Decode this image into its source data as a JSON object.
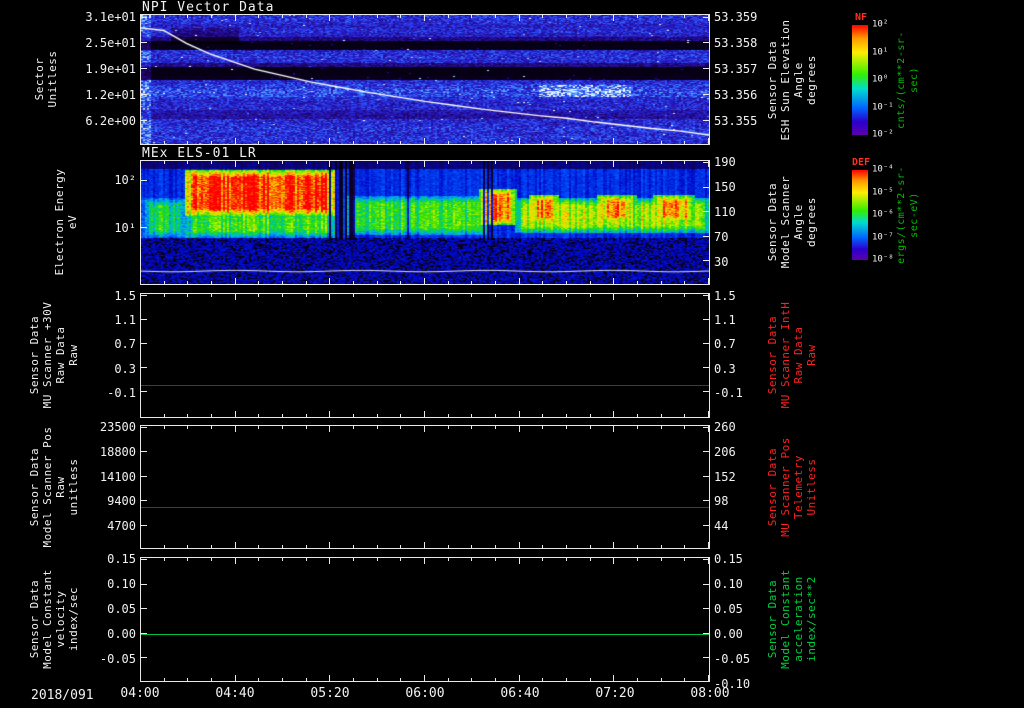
{
  "page": {
    "background": "#000000"
  },
  "time_axis": {
    "date_label": "2018/091",
    "tick_labels": [
      "04:00",
      "04:40",
      "05:20",
      "06:00",
      "06:40",
      "07:20",
      "08:00"
    ]
  },
  "panels": [
    {
      "title": "NPI Vector Data",
      "left_label": "Sector\nUnitless",
      "left_ticks": [
        "3.1e+01",
        "2.5e+01",
        "1.9e+01",
        "1.2e+01",
        "6.2e+00"
      ],
      "right_ticks": [
        "53.359",
        "53.358",
        "53.357",
        "53.356",
        "53.355"
      ],
      "right_label": "Sensor Data\nESH Sun Elevation\nAngle\ndegrees",
      "right_label_color": "#f2f2f2"
    },
    {
      "title": "MEx ELS-01 LR",
      "left_label": "Electron Energy\neV",
      "left_ticks": [
        "10²",
        "10¹"
      ],
      "right_ticks": [
        "190",
        "150",
        "110",
        "70",
        "30"
      ],
      "right_label": "Sensor Data\nModel Scanner\nAngle\ndegrees",
      "right_label_color": "#f2f2f2"
    },
    {
      "left_label": "Sensor Data\nMU Scanner +30V\nRaw Data\nRaw",
      "left_ticks": [
        "1.5",
        "1.1",
        "0.7",
        "0.3",
        "-0.1"
      ],
      "right_ticks": [
        "1.5",
        "1.1",
        "0.7",
        "0.3",
        "-0.1"
      ],
      "right_label": "Sensor Data\nMU Scanner IntH\nRaw Data\nRaw",
      "right_label_color": "#ff2020"
    },
    {
      "left_label": "Sensor Data\nModel Scanner Pos\nRaw\nunitless",
      "left_ticks": [
        "23500",
        "18800",
        "14100",
        "9400",
        "4700"
      ],
      "right_ticks": [
        "260",
        "206",
        "152",
        "98",
        "44"
      ],
      "right_label": "Sensor Data\nMU Scanner Pos\nTelemetry\nUnitless",
      "right_label_color": "#ff2020"
    },
    {
      "left_label": "Sensor Data\nModel Constant\nvelocity\nindex/sec",
      "left_ticks": [
        "0.15",
        "0.10",
        "0.05",
        "0.00",
        "-0.05"
      ],
      "right_ticks": [
        "0.15",
        "0.10",
        "0.05",
        "0.00",
        "-0.05",
        "-0.10"
      ],
      "right_label": "Sensor Data\nModel Constant\nacceleration\nindex/sec**2",
      "right_label_color": "#00d040"
    }
  ],
  "colorbars": [
    {
      "title": "NF",
      "ticks": [
        "10²",
        "10¹",
        "10⁰",
        "10⁻¹",
        "10⁻²"
      ],
      "units": "cnts/(cm**2-sr-sec)"
    },
    {
      "title": "DEF",
      "ticks": [
        "10⁻⁴",
        "10⁻⁵",
        "10⁻⁶",
        "10⁻⁷",
        "10⁻⁸"
      ],
      "units": "ergs/(cm**2-sr-sec-eV)"
    }
  ],
  "chart_data": [
    {
      "type": "heatmap",
      "title": "NPI Vector Data",
      "ylabel": "Sector (Unitless)",
      "yticks": [
        31,
        25,
        19,
        12,
        6.2
      ],
      "x_span": [
        "2018/091 04:00",
        "2018/091 08:00"
      ],
      "z_label": "NF cnts/(cm**2-sr-sec)",
      "z_log_range": [
        -2,
        2
      ],
      "description": "Low-count blue/purple sector-vs-time spectrogram with black bands near sectors 17-19 and 24-25",
      "overlay": {
        "name": "ESH Sun Elevation Angle",
        "units": "degrees",
        "right_axis_ticks": [
          53.359,
          53.358,
          53.357,
          53.356,
          53.355
        ],
        "start_value": 53.3585,
        "end_value": 53.3552,
        "curve_xfrac": [
          0,
          0.04,
          0.08,
          0.12,
          0.16,
          0.2,
          0.25,
          0.3,
          0.35,
          0.4,
          0.45,
          0.5,
          0.55,
          0.6,
          0.65,
          0.7,
          0.75,
          0.8,
          0.85,
          0.9,
          0.95,
          1
        ],
        "curve_yfrac": [
          0.1,
          0.12,
          0.22,
          0.3,
          0.36,
          0.42,
          0.47,
          0.52,
          0.56,
          0.6,
          0.635,
          0.67,
          0.7,
          0.73,
          0.755,
          0.78,
          0.8,
          0.83,
          0.855,
          0.88,
          0.9,
          0.93
        ]
      },
      "render": {
        "seed": 12345,
        "rows": [
          0.52,
          0.5,
          0.46,
          0.5,
          0.46,
          0.3,
          0.05,
          0.06,
          0.5,
          0.52,
          0.5,
          0.3,
          0.05,
          0.05,
          0.07,
          0.5,
          0.55,
          0.6,
          0.58,
          0.5,
          0.47,
          0.5,
          0.4,
          0.36,
          0.5,
          0.5,
          0.53,
          0.5,
          0.53,
          0.5
        ],
        "patches": [
          {
            "x0": 0.05,
            "x1": 0.17,
            "y0": 0.1,
            "y1": 0.22,
            "boost": -0.18
          },
          {
            "x0": 0.7,
            "x1": 0.86,
            "y0": 0.54,
            "y1": 0.63,
            "boost": 0.22
          },
          {
            "x0": 0.0,
            "x1": 0.015,
            "y0": 0.0,
            "y1": 1.0,
            "boost": 0.18
          }
        ],
        "colormap": [
          [
            0,
            "#000005"
          ],
          [
            0.18,
            "#17003f"
          ],
          [
            0.33,
            "#250c96"
          ],
          [
            0.5,
            "#2526d8"
          ],
          [
            0.63,
            "#2e4df0"
          ],
          [
            0.75,
            "#3f8bff"
          ],
          [
            0.88,
            "#9fd4ff"
          ],
          [
            1,
            "#ffffff"
          ]
        ]
      }
    },
    {
      "type": "heatmap",
      "title": "MEx ELS-01 LR",
      "ylabel": "Electron Energy (eV)",
      "yticks": [
        100,
        10
      ],
      "right_axis": {
        "name": "Model Scanner Angle (degrees)",
        "ticks": [
          190,
          150,
          110,
          70,
          30
        ]
      },
      "z_label": "DEF ergs/(cm**2-sr-sec-eV)",
      "z_log_range": [
        -8,
        -4
      ],
      "description": "Electron energy-time spectrogram: intense red high-energy band 04:10-05:20, striped green band 05:25-06:25, yellow-green band with red patches 06:30-08:00, blue noisy background below",
      "render": {
        "seed": 777,
        "bg_levels": {
          "top": 0.15,
          "mid": 0.27,
          "bottom": 0.21
        },
        "regions": [
          {
            "x0": 0.0,
            "x1": 0.08,
            "y0": 0.3,
            "y1": 0.62,
            "v": 0.52
          },
          {
            "x0": 0.075,
            "x1": 0.345,
            "y0": 0.07,
            "y1": 0.44,
            "v": 0.97
          },
          {
            "x0": 0.075,
            "x1": 0.345,
            "y0": 0.4,
            "y1": 0.62,
            "v": 0.58
          },
          {
            "x0": 0.36,
            "x1": 0.61,
            "y0": 0.28,
            "y1": 0.6,
            "v": 0.56
          },
          {
            "x0": 0.595,
            "x1": 0.66,
            "y0": 0.22,
            "y1": 0.52,
            "v": 0.9
          },
          {
            "x0": 0.655,
            "x1": 1.0,
            "y0": 0.3,
            "y1": 0.58,
            "v": 0.66
          },
          {
            "x0": 0.68,
            "x1": 0.735,
            "y0": 0.27,
            "y1": 0.5,
            "v": 0.88
          },
          {
            "x0": 0.8,
            "x1": 0.87,
            "y0": 0.27,
            "y1": 0.5,
            "v": 0.85
          },
          {
            "x0": 0.9,
            "x1": 0.975,
            "y0": 0.27,
            "y1": 0.5,
            "v": 0.85
          }
        ],
        "stripe_zone": [
          0.34,
          0.62
        ],
        "white_line_yfrac": 0.895,
        "colormap": [
          [
            0,
            "#000000"
          ],
          [
            0.1,
            "#120040"
          ],
          [
            0.22,
            "#0008c8"
          ],
          [
            0.33,
            "#0055ff"
          ],
          [
            0.42,
            "#00b4e6"
          ],
          [
            0.5,
            "#00d060"
          ],
          [
            0.58,
            "#3ae000"
          ],
          [
            0.68,
            "#b8f000"
          ],
          [
            0.78,
            "#ffd800"
          ],
          [
            0.88,
            "#ff7000"
          ],
          [
            1,
            "#ff0000"
          ]
        ]
      }
    },
    {
      "type": "line",
      "name": "Sensor Data MU Scanner +30V Raw Data",
      "value": 0.0,
      "yticks_left": [
        1.5,
        1.1,
        0.7,
        0.3,
        -0.1
      ],
      "yticks_right": [
        1.5,
        1.1,
        0.7,
        0.3,
        -0.1
      ],
      "color": "#cc0000",
      "line_frac": 0.736
    },
    {
      "type": "line",
      "name": "Sensor Data Model Scanner Pos Raw",
      "value": 8800,
      "yticks_left": [
        23500,
        18800,
        14100,
        9400,
        4700
      ],
      "yticks_right": [
        260,
        206,
        152,
        98,
        44
      ],
      "color": "#cc0000",
      "line_frac": 0.661
    },
    {
      "type": "line",
      "name": "Sensor Data Model Constant velocity",
      "value": 0.0,
      "yticks_left": [
        0.15,
        0.1,
        0.05,
        0.0,
        -0.05
      ],
      "yticks_right": [
        0.15,
        0.1,
        0.05,
        0.0,
        -0.05,
        -0.1
      ],
      "color": "#00c040",
      "line_frac": 0.616
    }
  ]
}
